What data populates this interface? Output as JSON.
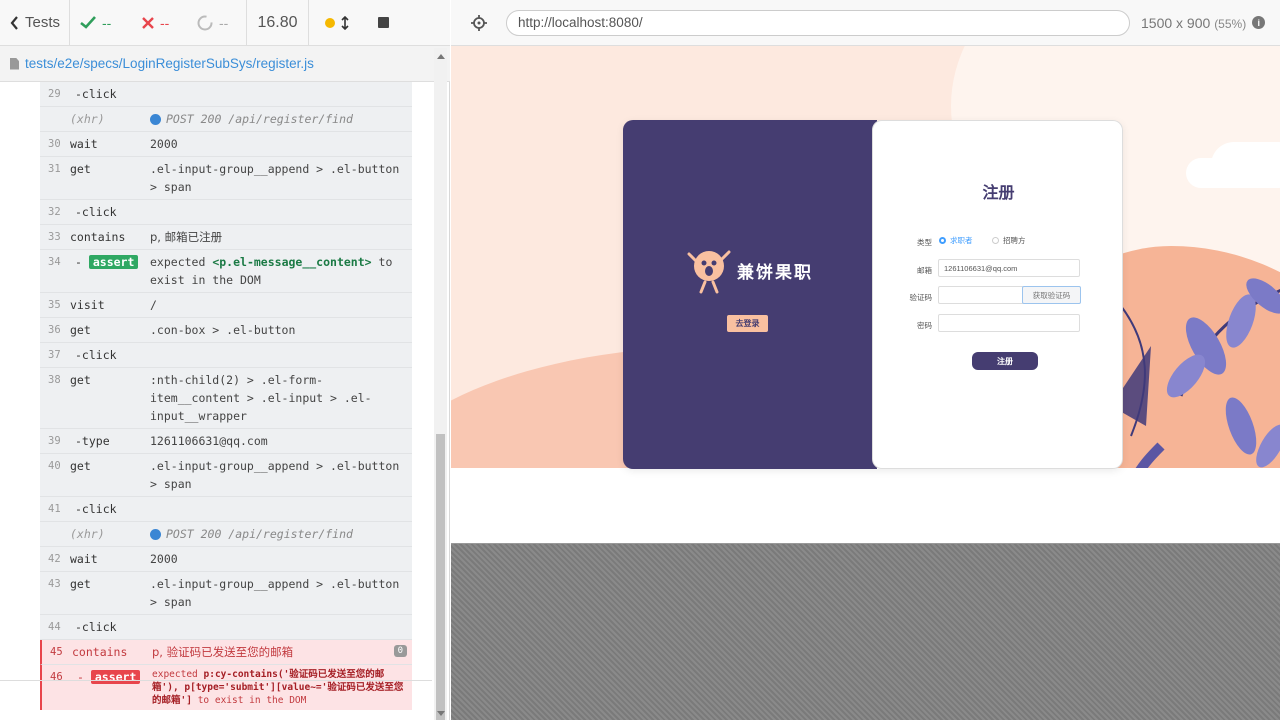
{
  "topbar": {
    "tests_label": "Tests",
    "passed": "--",
    "failed": "--",
    "pending": "--",
    "duration": "16.80"
  },
  "spec": {
    "path": "tests/e2e/specs/LoginRegisterSubSys/register.js"
  },
  "commands": [
    {
      "ln": "29",
      "cmd": "-click",
      "msg": ""
    },
    {
      "ln": "",
      "cmd": "(xhr)",
      "msg": "POST 200 /api/register/find"
    },
    {
      "ln": "30",
      "cmd": "wait",
      "msg": "2000"
    },
    {
      "ln": "31",
      "cmd": "get",
      "msg": ".el-input-group__append > .el-button > span"
    },
    {
      "ln": "32",
      "cmd": "-click",
      "msg": ""
    },
    {
      "ln": "33",
      "cmd": "contains",
      "msg": "p, 邮箱已注册"
    },
    {
      "ln": "34",
      "cmd": "assert",
      "msg_pre": "expected",
      "msg_strong": "<p.el-message__content>",
      "msg_post": "to exist in the DOM"
    },
    {
      "ln": "35",
      "cmd": "visit",
      "msg": "/"
    },
    {
      "ln": "36",
      "cmd": "get",
      "msg": ".con-box > .el-button"
    },
    {
      "ln": "37",
      "cmd": "-click",
      "msg": ""
    },
    {
      "ln": "38",
      "cmd": "get",
      "msg": ":nth-child(2) > .el-form-item__content > .el-input > .el-input__wrapper"
    },
    {
      "ln": "39",
      "cmd": "-type",
      "msg": "1261106631@qq.com"
    },
    {
      "ln": "40",
      "cmd": "get",
      "msg": ".el-input-group__append > .el-button > span"
    },
    {
      "ln": "41",
      "cmd": "-click",
      "msg": ""
    },
    {
      "ln": "",
      "cmd": "(xhr)",
      "msg": "POST 200 /api/register/find"
    },
    {
      "ln": "42",
      "cmd": "wait",
      "msg": "2000"
    },
    {
      "ln": "43",
      "cmd": "get",
      "msg": ".el-input-group__append > .el-button > span"
    },
    {
      "ln": "44",
      "cmd": "-click",
      "msg": ""
    },
    {
      "ln": "45",
      "cmd": "contains",
      "msg": "p, 验证码已发送至您的邮箱",
      "count": "0"
    },
    {
      "ln": "46",
      "cmd": "assert",
      "msg_pre": "expected",
      "msg_strong": "p:cy-contains('验证码已发送至您的邮箱'), p[type='submit'][value~='验证码已发送至您的邮箱']",
      "msg_post": "to exist in the DOM"
    }
  ],
  "aut": {
    "url": "http://localhost:8080/",
    "viewport": "1500 x 900",
    "scale": "(55%)",
    "info": "i"
  },
  "app": {
    "brand": "兼饼果职",
    "goto_login": "去登录",
    "register_title": "注册",
    "type_label": "类型",
    "type_options": [
      "求职者",
      "招聘方"
    ],
    "email_label": "邮箱",
    "email_value": "1261106631@qq.com",
    "code_label": "验证码",
    "code_button": "获取验证码",
    "password_label": "密码",
    "submit_label": "注册"
  },
  "colors": {
    "pass": "#2f9e5b",
    "fail": "#e8454c",
    "link": "#3b8ed8",
    "brand_purple": "#453d71",
    "peach": "#f9c0a0"
  }
}
